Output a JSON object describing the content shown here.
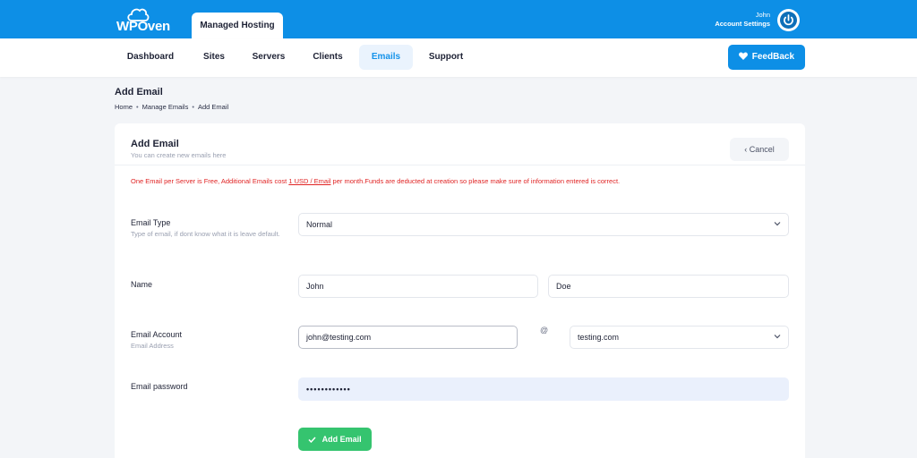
{
  "brand": {
    "logo_text": "WPOven"
  },
  "header": {
    "hosting_tab": "Managed Hosting",
    "user_name": "John",
    "account_settings": "Account Settings"
  },
  "nav": {
    "items": [
      {
        "label": "Dashboard"
      },
      {
        "label": "Sites"
      },
      {
        "label": "Servers"
      },
      {
        "label": "Clients"
      },
      {
        "label": "Emails"
      },
      {
        "label": "Support"
      }
    ],
    "active": "Emails",
    "feedback_label": "FeedBack"
  },
  "page": {
    "title": "Add Email",
    "breadcrumb": [
      "Home",
      "Manage Emails",
      "Add Email"
    ]
  },
  "card": {
    "title": "Add Email",
    "subtitle": "You can create new emails here",
    "cancel_label": "Cancel",
    "notice_pre": "One Email per Server is Free, Additional Emails cost ",
    "notice_link": "1 USD / Email",
    "notice_post": " per month.Funds are deducted at creation so please make sure of information entered is correct."
  },
  "form": {
    "email_type": {
      "label": "Email Type",
      "hint": "Type of email, if dont know what it is leave default.",
      "value": "Normal"
    },
    "name": {
      "label": "Name",
      "first": "John",
      "last": "Doe"
    },
    "email_account": {
      "label": "Email Account",
      "hint": "Email Address",
      "value": "john@testing.com",
      "at": "@",
      "domain": "testing.com"
    },
    "password": {
      "label": "Email password",
      "value": "••••••••••••"
    },
    "submit_label": "Add Email"
  },
  "colors": {
    "primary": "#0d8fe6",
    "success": "#35c46f",
    "danger": "#e02424",
    "background": "#f3f5f8"
  }
}
